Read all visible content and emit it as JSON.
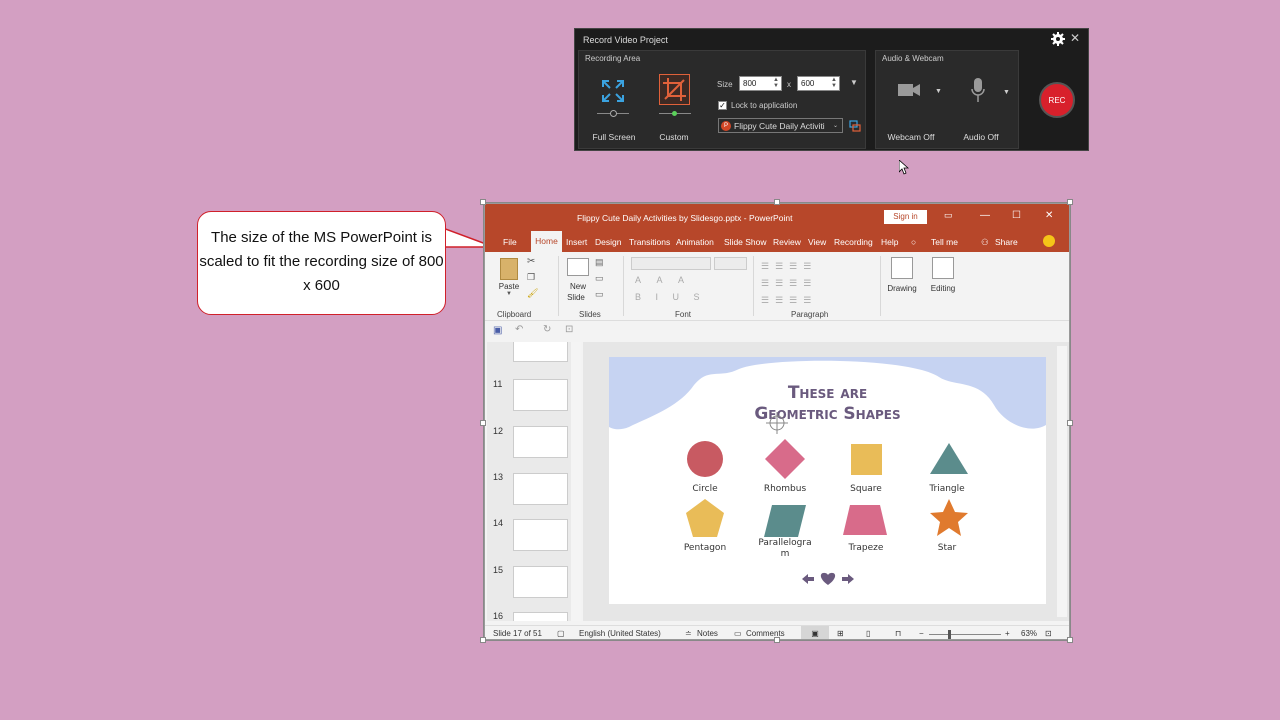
{
  "recorder": {
    "title": "Record Video Project",
    "recording_area_label": "Recording Area",
    "full_screen_label": "Full Screen",
    "custom_label": "Custom",
    "size_label": "Size",
    "width_value": "800",
    "times": "x",
    "height_value": "600",
    "lock_label": "Lock to application",
    "lock_checked": true,
    "app_select": "Flippy Cute Daily Activiti",
    "audio_webcam_label": "Audio & Webcam",
    "webcam_label": "Webcam Off",
    "audio_label": "Audio Off",
    "rec_label": "REC",
    "accent": "#d8202b"
  },
  "callout": {
    "text": "The size of the MS PowerPoint is scaled to fit the recording size of 800 x 600"
  },
  "ppt": {
    "title": "Flippy Cute Daily Activities by Slidesgo.pptx  -  PowerPoint",
    "sign_in": "Sign in",
    "brand_color": "#b7472a",
    "tabs": {
      "file": "File",
      "home": "Home",
      "insert": "Insert",
      "design": "Design",
      "transitions": "Transitions",
      "animation": "Animation",
      "slide_show": "Slide Show",
      "review": "Review",
      "view": "View",
      "recording": "Recording",
      "help": "Help",
      "tell_me": "Tell me",
      "share": "Share"
    },
    "ribbon": {
      "paste": "Paste",
      "new_slide": "New",
      "new_slide2": "Slide",
      "drawing": "Drawing",
      "editing": "Editing",
      "groups": {
        "clipboard": "Clipboard",
        "slides": "Slides",
        "font": "Font",
        "paragraph": "Paragraph"
      }
    },
    "thumbnail_numbers": [
      "11",
      "12",
      "13",
      "14",
      "15",
      "16"
    ],
    "slide": {
      "title_line1": "These are",
      "title_line2": "Geometric Shapes",
      "shapes": {
        "circle": "Circle",
        "rhombus": "Rhombus",
        "square": "Square",
        "triangle": "Triangle",
        "pentagon": "Pentagon",
        "parallelogram_a": "Parallelogra",
        "parallelogram_b": "m",
        "trapeze": "Trapeze",
        "star": "Star"
      },
      "colors": {
        "circle": "#c85a62",
        "rhombus": "#d86b8a",
        "square": "#e9bc58",
        "triangle": "#5b8c8c",
        "pentagon": "#e9bc58",
        "parallelogram": "#5b8c8c",
        "trapeze": "#d86b8a",
        "star": "#e07a2e",
        "cloud": "#c6d3f2",
        "title": "#6a5a7e"
      }
    },
    "status": {
      "slide_info": "Slide 17 of 51",
      "language": "English (United States)",
      "notes": "Notes",
      "comments": "Comments",
      "zoom": "63%"
    }
  }
}
